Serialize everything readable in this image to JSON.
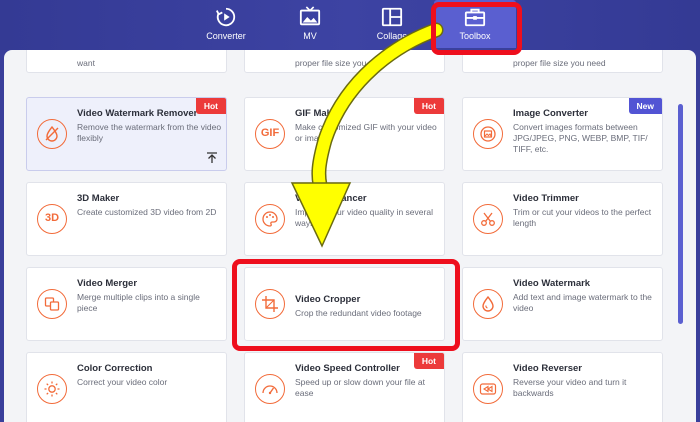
{
  "nav": {
    "items": [
      {
        "label": "Converter",
        "icon": "converter-icon"
      },
      {
        "label": "MV",
        "icon": "mv-icon"
      },
      {
        "label": "Collage",
        "icon": "collage-icon"
      },
      {
        "label": "Toolbox",
        "icon": "toolbox-icon"
      }
    ],
    "active": "Toolbox"
  },
  "cards": {
    "row0": [
      {
        "desc": "want"
      },
      {
        "desc": "proper file size you need"
      },
      {
        "desc": "proper file size you need"
      }
    ],
    "watermark_remover": {
      "title": "Video Watermark Remover",
      "desc": "Remove the watermark from the video flexibly",
      "badge": "Hot"
    },
    "gif_maker": {
      "title": "GIF Maker",
      "desc": "Make customized GIF with your video or images",
      "badge": "Hot"
    },
    "image_converter": {
      "title": "Image Converter",
      "desc": "Convert images formats between JPG/JPEG, PNG, WEBP, BMP, TIF/ TIFF, etc.",
      "badge": "New"
    },
    "maker_3d": {
      "title": "3D Maker",
      "desc": "Create customized 3D video from 2D"
    },
    "video_enhancer": {
      "title": "Video Enhancer",
      "desc": "Improve your video quality in several ways"
    },
    "video_trimmer": {
      "title": "Video Trimmer",
      "desc": "Trim or cut your videos to the perfect length"
    },
    "video_merger": {
      "title": "Video Merger",
      "desc": "Merge multiple clips into a single piece"
    },
    "video_cropper": {
      "title": "Video Cropper",
      "desc": "Crop the redundant video footage"
    },
    "video_watermark": {
      "title": "Video Watermark",
      "desc": "Add text and image watermark to the video"
    },
    "color_correction": {
      "title": "Color Correction",
      "desc": "Correct your video color"
    },
    "speed_controller": {
      "title": "Video Speed Controller",
      "desc": "Speed up or slow down your file at ease",
      "badge": "Hot"
    },
    "video_reverser": {
      "title": "Video Reverser",
      "desc": "Reverse your video and turn it backwards"
    }
  },
  "icon_text": {
    "gif": "GIF",
    "three_d": "3D"
  },
  "colors": {
    "accent": "#f26b3a",
    "nav_bg": "#3a3f9b",
    "nav_active": "#5a5fd0",
    "hot": "#ec3a3a",
    "new": "#5254d4",
    "highlight": "#ee0f1d",
    "arrow": "#ffff00"
  }
}
